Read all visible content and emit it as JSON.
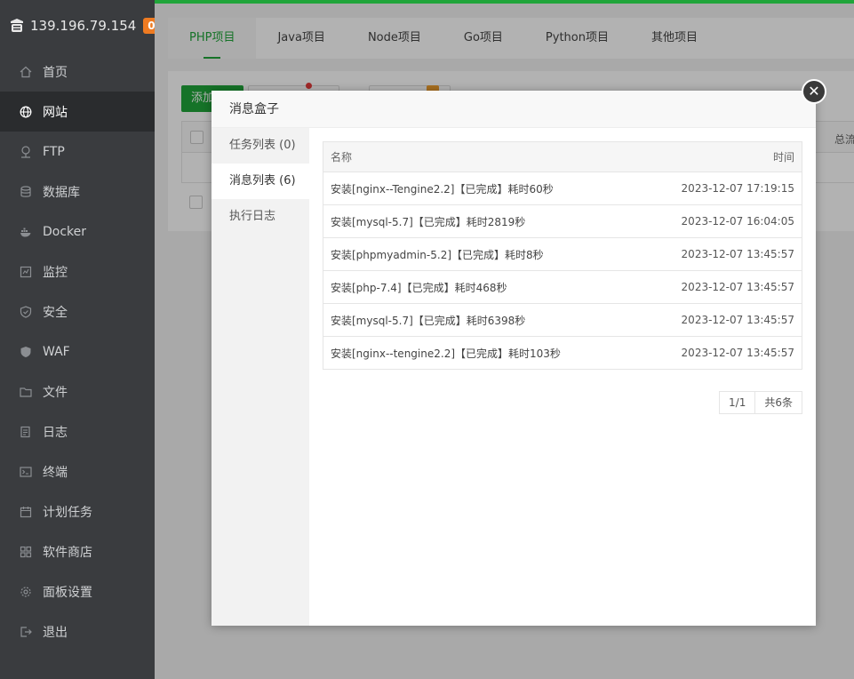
{
  "sidebar": {
    "ip": "139.196.79.154",
    "badge": "0",
    "items": [
      {
        "label": "首页",
        "icon": "home-icon"
      },
      {
        "label": "网站",
        "icon": "globe-icon",
        "active": true
      },
      {
        "label": "FTP",
        "icon": "ftp-icon"
      },
      {
        "label": "数据库",
        "icon": "database-icon"
      },
      {
        "label": "Docker",
        "icon": "docker-icon"
      },
      {
        "label": "监控",
        "icon": "monitor-icon"
      },
      {
        "label": "安全",
        "icon": "shield-icon"
      },
      {
        "label": "WAF",
        "icon": "waf-icon"
      },
      {
        "label": "文件",
        "icon": "folder-icon"
      },
      {
        "label": "日志",
        "icon": "log-icon"
      },
      {
        "label": "终端",
        "icon": "terminal-icon"
      },
      {
        "label": "计划任务",
        "icon": "calendar-icon"
      },
      {
        "label": "软件商店",
        "icon": "apps-icon"
      },
      {
        "label": "面板设置",
        "icon": "gear-icon"
      },
      {
        "label": "退出",
        "icon": "logout-icon"
      }
    ]
  },
  "tabs": [
    "PHP项目",
    "Java项目",
    "Node项目",
    "Go项目",
    "Python项目",
    "其他项目"
  ],
  "toolbar": {
    "add_label": "添加",
    "total_traffic": "总流量"
  },
  "modal": {
    "title": "消息盒子",
    "side": [
      "任务列表 (0)",
      "消息列表 (6)",
      "执行日志"
    ],
    "headers": {
      "name": "名称",
      "time": "时间"
    },
    "rows": [
      {
        "name": "安装[nginx--Tengine2.2]【已完成】耗时60秒",
        "time": "2023-12-07 17:19:15"
      },
      {
        "name": "安装[mysql-5.7]【已完成】耗时2819秒",
        "time": "2023-12-07 16:04:05"
      },
      {
        "name": "安装[phpmyadmin-5.2]【已完成】耗时8秒",
        "time": "2023-12-07 13:45:57"
      },
      {
        "name": "安装[php-7.4]【已完成】耗时468秒",
        "time": "2023-12-07 13:45:57"
      },
      {
        "name": "安装[mysql-5.7]【已完成】耗时6398秒",
        "time": "2023-12-07 13:45:57"
      },
      {
        "name": "安装[nginx--tengine2.2]【已完成】耗时103秒",
        "time": "2023-12-07 13:45:57"
      }
    ],
    "pager": {
      "page": "1/1",
      "total": "共6条"
    }
  },
  "colors": {
    "accent": "#20a53a",
    "sidebar_bg": "#3a3c3f",
    "badge": "#ee7b22"
  }
}
